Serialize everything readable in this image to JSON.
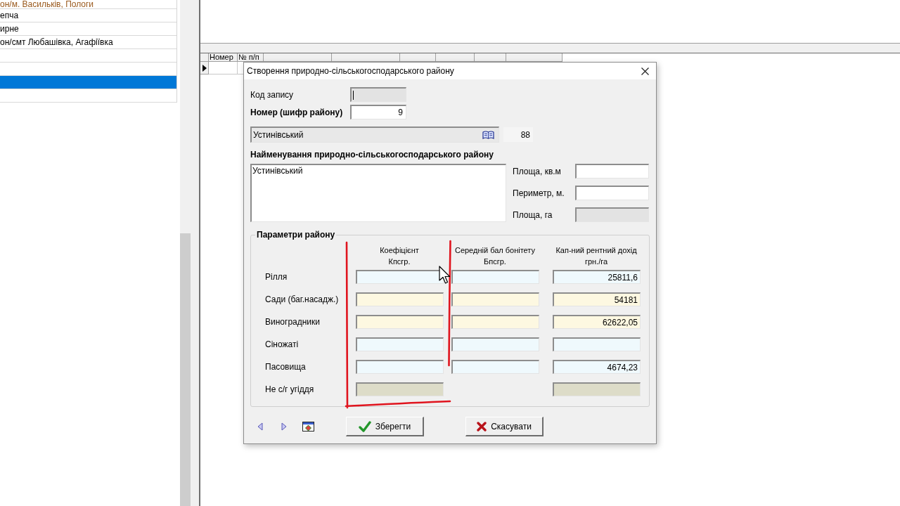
{
  "left_list": {
    "items": [
      {
        "text": "он/м. Васильків, Пологи",
        "color": "#9a5a1e",
        "selected": false
      },
      {
        "text": "епча",
        "color": "#000000",
        "selected": false
      },
      {
        "text": "ирне",
        "color": "#000000",
        "selected": false
      },
      {
        "text": "он/смт Любашівка, Агафіївка",
        "color": "#000000",
        "selected": false
      },
      {
        "selected": false
      },
      {
        "selected": false
      },
      {
        "selected": true
      },
      {
        "selected": false
      }
    ]
  },
  "grid": {
    "columns": [
      "Номер",
      "№ п/п"
    ],
    "rows": [
      {
        "current": true
      }
    ]
  },
  "dialog": {
    "title": "Створення природно-сільськогосподарського району",
    "record_code": {
      "label": "Код запису",
      "disabled": true,
      "focused": true
    },
    "number": {
      "label": "Номер (шифр району)",
      "value": "9"
    },
    "lookup": {
      "value": "Устинівський",
      "code": "88"
    },
    "name": {
      "label": "Найменування природно-сільськогосподарського району",
      "value": "Устинівський"
    },
    "measures": [
      {
        "label": "Площа, кв.м",
        "disabled": false
      },
      {
        "label": "Периметр, м.",
        "disabled": false
      },
      {
        "label": "Площа, га",
        "disabled": true
      }
    ],
    "params": {
      "title": "Параметри району",
      "columns": [
        "Коефіцієнт\nКпсгр.",
        "Середній бал бонітету\nБпсгр.",
        "Кап-ний рентний дохід\nгрн./га"
      ],
      "rows": [
        {
          "label": "Рілля",
          "color": "#eff9fd",
          "score_field": true,
          "income": "25811,6"
        },
        {
          "label": "Сади (баг.насадж.)",
          "color": "#fdf8e1",
          "score_field": true,
          "income": "54181"
        },
        {
          "label": "Виноградники",
          "color": "#fdf8e1",
          "score_field": true,
          "income": "62622,05"
        },
        {
          "label": "Сіножаті",
          "color": "#eff9fd",
          "score_field": true
        },
        {
          "label": "Пасовища",
          "color": "#eff9fd",
          "score_field": true,
          "income": "4674,23"
        },
        {
          "label": "Не с/г угіддя",
          "color": "#dddcc8",
          "score_field": false
        }
      ]
    },
    "buttons": [
      {
        "label": "Зберегти",
        "kind": "save"
      },
      {
        "label": "Скасувати",
        "kind": "cancel"
      }
    ]
  }
}
